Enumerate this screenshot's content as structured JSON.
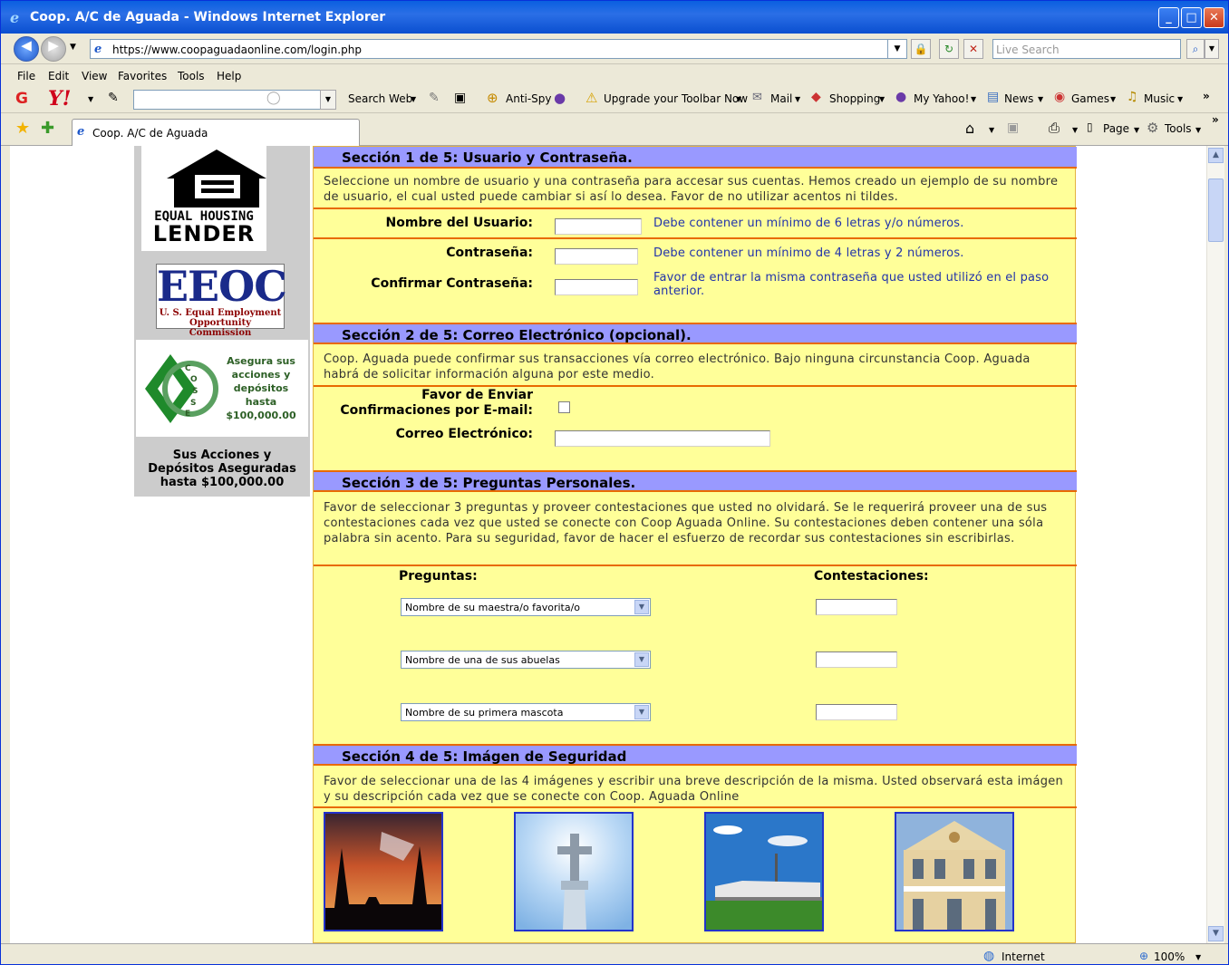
{
  "window": {
    "title": "Coop. A/C de Aguada - Windows Internet Explorer",
    "minimize": "_",
    "maximize": "□",
    "close": "✕"
  },
  "address": {
    "url": "https://www.coopaguadaonline.com/login.php",
    "live_search_placeholder": "Live Search"
  },
  "menu": [
    "File",
    "Edit",
    "View",
    "Favorites",
    "Tools",
    "Help"
  ],
  "yahoo_toolbar": {
    "search_web": "Search Web",
    "anti_spy": "Anti-Spy",
    "upgrade": "Upgrade your Toolbar Now",
    "mail": "Mail",
    "shopping": "Shopping",
    "my_yahoo": "My Yahoo!",
    "news": "News",
    "games": "Games",
    "music": "Music"
  },
  "tab": {
    "label": "Coop. A/C de Aguada",
    "page": "Page",
    "tools": "Tools"
  },
  "sidebar": {
    "ehl_line1": "EQUAL HOUSING",
    "ehl_line2": "LENDER",
    "eeoc_big": "EEOC",
    "eeoc_sub1": "U. S. Equal Employment",
    "eeoc_sub2": "Opportunity Commission",
    "cosse_lines": [
      "Asegura sus",
      "acciones y",
      "depósitos",
      "hasta",
      "$100,000.00"
    ],
    "aseguradas_lines": [
      "Sus Acciones y",
      "Depósitos Aseguradas",
      "hasta $100,000.00"
    ]
  },
  "section1": {
    "header": "Sección 1 de 5: Usuario y Contraseña.",
    "intro": "Seleccione un nombre de usuario y una contraseña para accesar sus cuentas. Hemos creado un ejemplo de su nombre de usuario, el cual usted puede cambiar si así lo desea. Favor de no utilizar acentos ni tildes.",
    "username_label": "Nombre del Usuario:",
    "username_help": "Debe contener un mínimo de 6 letras y/o números.",
    "password_label": "Contraseña:",
    "password_help": "Debe contener un mínimo de 4 letras y 2 números.",
    "confirm_label": "Confirmar Contraseña:",
    "confirm_help": "Favor de entrar la misma contraseña que usted utilizó en el paso anterior."
  },
  "section2": {
    "header": "Sección 2 de 5: Correo Electrónico (opcional).",
    "intro": "Coop. Aguada puede confirmar sus transacciones vía correo electrónico. Bajo ninguna circunstancia Coop. Aguada habrá de solicitar información alguna por este medio.",
    "confirm_email_label_1": "Favor de Enviar",
    "confirm_email_label_2": "Confirmaciones por E-mail:",
    "email_label": "Correo Electrónico:"
  },
  "section3": {
    "header": "Sección 3 de 5: Preguntas Personales.",
    "intro": "Favor de seleccionar 3 preguntas y proveer contestaciones que usted no olvidará. Se le requerirá proveer una de sus contestaciones cada vez que usted se conecte con Coop Aguada Online. Su contestaciones deben contener una sóla palabra sin acento. Para su seguridad, favor de hacer el esfuerzo de recordar sus contestaciones sin escribirlas.",
    "questions_label": "Preguntas:",
    "answers_label": "Contestaciones:",
    "questions": [
      "Nombre de su maestra/o favorita/o",
      "Nombre de una de sus abuelas",
      "Nombre de su primera mascota"
    ]
  },
  "section4": {
    "header": "Sección 4 de 5: Imágen de Seguridad",
    "intro": "Favor de seleccionar una de las 4 imágenes y escribir una breve descripción de la misma. Usted observará esta imágen y su descripción cada vez que se conecte con Coop. Aguada Online",
    "images": [
      "church-silhouette-sunset",
      "cross-on-tower",
      "sugar-mill-field",
      "colonial-building"
    ]
  },
  "status": {
    "zone": "Internet",
    "zoom": "100%"
  }
}
